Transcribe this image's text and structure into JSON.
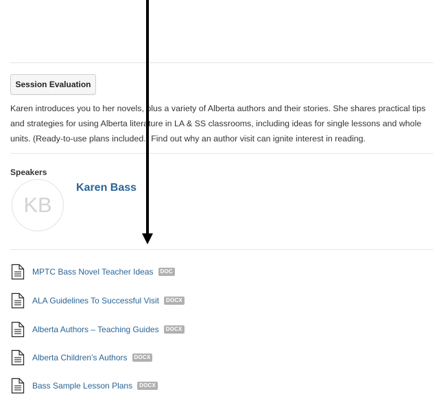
{
  "session": {
    "evaluation_button": "Session Evaluation",
    "description": "Karen introduces you to her novels, plus a variety of Alberta authors and their stories. She shares practical tips and strategies for using Alberta literature in LA & SS classrooms, including ideas for single lessons and whole units. (Ready-to-use plans included.) Find out why an author visit can ignite interest in reading."
  },
  "speakers": {
    "heading": "Speakers",
    "items": [
      {
        "initials": "KB",
        "name": "Karen Bass"
      }
    ]
  },
  "files": [
    {
      "icon": "document-icon",
      "name": "MPTC Bass Novel Teacher Ideas",
      "type": "DOC"
    },
    {
      "icon": "document-icon",
      "name": "ALA Guidelines To Successful Visit",
      "type": "DOCX"
    },
    {
      "icon": "document-icon",
      "name": "Alberta Authors – Teaching Guides",
      "type": "DOCX"
    },
    {
      "icon": "document-icon",
      "name": "Alberta Children’s Authors",
      "type": "DOCX"
    },
    {
      "icon": "document-icon",
      "name": "Bass Sample Lesson Plans",
      "type": "DOCX"
    }
  ],
  "colors": {
    "link": "#2a6496",
    "badge": "#b0b0b0",
    "arrow": "#000000"
  }
}
